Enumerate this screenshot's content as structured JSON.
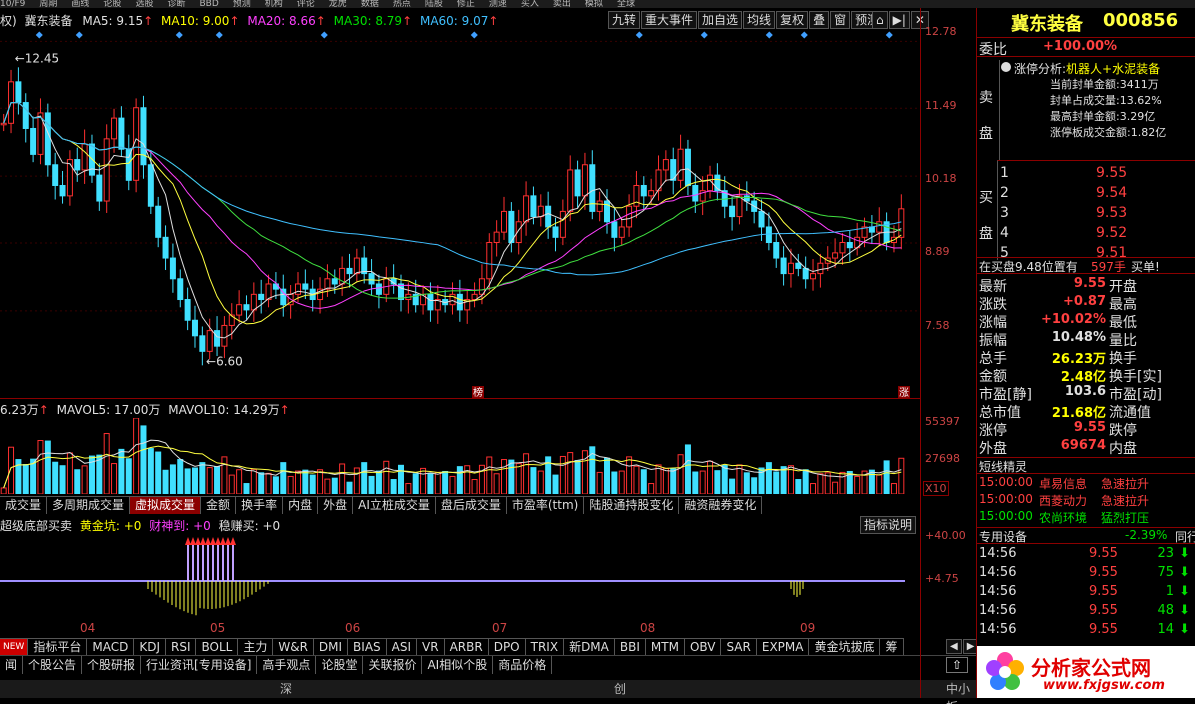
{
  "topbar": {
    "items": [
      "10/F9",
      "周期",
      "画线",
      "论股",
      "选股",
      "诊断",
      "BBD",
      "预测",
      "机构",
      "评论",
      "龙虎",
      "数据",
      "热点",
      "陆股",
      "修正",
      "测速",
      "买入",
      "卖出",
      "模拟",
      "全球"
    ]
  },
  "legend": {
    "prefix": "权)",
    "stock": "冀东装备",
    "ma5": "MA5: 9.15",
    "ma10": "MA10: 9.00",
    "ma20": "MA20: 8.66",
    "ma30": "MA30: 8.79",
    "ma60": "MA60: 9.07"
  },
  "toolbar": [
    "九转",
    "重大事件",
    "加自选",
    "均线",
    "复权",
    "叠",
    "窗",
    "预测"
  ],
  "price_axis": [
    "12.78",
    "11.49",
    "10.18",
    "8.89",
    "7.58"
  ],
  "annotations": {
    "high": "12.45",
    "low": "6.60",
    "bang": "榜",
    "zhang": "涨"
  },
  "vol_legend": {
    "vol": "6.23万",
    "mavol5": "MAVOL5: 17.00万",
    "mavol10": "MAVOL10: 14.29万"
  },
  "vol_axis": [
    "55397",
    "27698",
    "X10"
  ],
  "mid_tabs": [
    "成交量",
    "多周期成交量",
    "虚拟成交量",
    "金额",
    "换手率",
    "内盘",
    "外盘",
    "AI立桩成交量",
    "盘后成交量",
    "市盈率(ttm)",
    "陆股通持股变化",
    "融资融券变化"
  ],
  "mid_tab_selected": 2,
  "ind_legend": {
    "name": "超级底部买卖",
    "a": "黄金坑: +0",
    "b": "财神到: +0",
    "c": "稳赚买: +0",
    "explain": "指标说明"
  },
  "ind_axis": [
    "+40.00",
    "+4.75"
  ],
  "months": [
    "04",
    "05",
    "06",
    "07",
    "08",
    "09"
  ],
  "ind_tabs": [
    "指标平台",
    "MACD",
    "KDJ",
    "RSI",
    "BOLL",
    "主力",
    "W&R",
    "DMI",
    "BIAS",
    "ASI",
    "VR",
    "ARBR",
    "DPO",
    "TRIX",
    "新DMA",
    "BBI",
    "MTM",
    "OBV",
    "SAR",
    "EXPMA",
    "黄金坑拔底",
    "筹"
  ],
  "new_badge": "NEW",
  "bottom_tabs": [
    "闻",
    "个股公告",
    "个股研报",
    "行业资讯[专用设备]",
    "高手观点",
    "论股堂",
    "关联报价",
    "AI相似个股",
    "商品价格"
  ],
  "status": {
    "a": "深",
    "b": "创",
    "c": "中小板"
  },
  "panel": {
    "title_name": "冀东装备",
    "title_code": "000856",
    "weibi_label": "委比",
    "weibi": "+100.00%",
    "sell_label": "卖盘",
    "limit_label": "涨停分析:",
    "limit_topic": "机器人+水泥装备",
    "limit_lines": [
      "当前封单金额:3411万",
      "封单占成交量:13.62%",
      "最高封单金额:3.29亿",
      "涨停板成交金额:1.82亿"
    ],
    "buy_label": "买盘",
    "buy": [
      {
        "n": "1",
        "p": "9.55"
      },
      {
        "n": "2",
        "p": "9.54"
      },
      {
        "n": "3",
        "p": "9.53"
      },
      {
        "n": "4",
        "p": "9.52"
      },
      {
        "n": "5",
        "p": "9.51"
      }
    ],
    "pos_text": "在买盘9.48位置有",
    "pos_vol": "597手",
    "pos_type": "买单!",
    "quotes": [
      {
        "l": "最新",
        "v": "9.55",
        "r": "开盘",
        "c": "red"
      },
      {
        "l": "涨跌",
        "v": "+0.87",
        "r": "最高",
        "c": "red"
      },
      {
        "l": "涨幅",
        "v": "+10.02%",
        "r": "最低",
        "c": "red"
      },
      {
        "l": "振幅",
        "v": "10.48%",
        "r": "量比",
        "c": "wht"
      },
      {
        "l": "总手",
        "v": "26.23万",
        "r": "换手",
        "c": "yel"
      },
      {
        "l": "金额",
        "v": "2.48亿",
        "r": "换手[实]",
        "c": "yel"
      },
      {
        "l": "市盈[静]",
        "v": "103.6",
        "r": "市盈[动]",
        "c": "wht"
      },
      {
        "l": "总市值",
        "v": "21.68亿",
        "r": "流通值",
        "c": "yel"
      },
      {
        "l": "涨停",
        "v": "9.55",
        "r": "跌停",
        "c": "red"
      },
      {
        "l": "外盘",
        "v": "69674",
        "r": "内盘",
        "c": "red"
      }
    ],
    "sprite_title": "短线精灵",
    "sprites": [
      {
        "t": "15:00:00",
        "n": "卓易信息",
        "e": "急速拉升",
        "c": "red"
      },
      {
        "t": "15:00:00",
        "n": "西菱动力",
        "e": "急速拉升",
        "c": "red"
      },
      {
        "t": "15:00:00",
        "n": "农尚环境",
        "e": "猛烈打压",
        "c": "grn"
      }
    ],
    "sector": "专用设备",
    "sector_chg": "-2.39%",
    "sector_tab": "同行",
    "ticks": [
      {
        "t": "14:56",
        "p": "9.55",
        "v": "23"
      },
      {
        "t": "14:56",
        "p": "9.55",
        "v": "75"
      },
      {
        "t": "14:56",
        "p": "9.55",
        "v": "1"
      },
      {
        "t": "14:56",
        "p": "9.55",
        "v": "48"
      },
      {
        "t": "14:56",
        "p": "9.55",
        "v": "14"
      }
    ],
    "logo_text": "分析家公式网",
    "logo_url": "www.fxjgsw.com"
  },
  "chart_data": {
    "type": "candlestick",
    "price_range": [
      5.9,
      13.0
    ],
    "ticks_y": [
      12.78,
      11.49,
      10.18,
      8.89,
      7.58
    ],
    "close": [
      11.2,
      12.0,
      11.6,
      11.1,
      10.6,
      11.4,
      10.4,
      10.0,
      9.8,
      10.5,
      10.3,
      10.8,
      10.2,
      9.7,
      10.9,
      11.3,
      10.7,
      10.1,
      11.5,
      10.4,
      9.6,
      9.0,
      8.6,
      8.2,
      7.8,
      7.4,
      7.1,
      6.8,
      7.2,
      6.9,
      7.3,
      7.5,
      7.7,
      7.6,
      7.9,
      7.8,
      8.1,
      8.0,
      7.7,
      7.9,
      8.1,
      8.0,
      7.8,
      8.0,
      8.2,
      8.1,
      8.4,
      8.3,
      8.6,
      8.3,
      8.1,
      7.9,
      8.2,
      8.1,
      7.8,
      7.9,
      7.7,
      7.9,
      7.6,
      7.8,
      7.7,
      7.9,
      7.6,
      7.8,
      7.9,
      8.2,
      8.9,
      9.1,
      9.5,
      8.9,
      9.3,
      9.8,
      9.4,
      9.6,
      9.2,
      9.0,
      9.5,
      10.3,
      9.8,
      10.4,
      9.5,
      9.7,
      9.3,
      9.0,
      9.2,
      9.6,
      10.0,
      9.8,
      9.9,
      10.3,
      10.5,
      10.1,
      10.7,
      10.0,
      9.7,
      9.9,
      10.2,
      9.9,
      9.6,
      9.4,
      9.8,
      9.7,
      9.5,
      9.2,
      8.9,
      8.6,
      8.3,
      8.5,
      8.4,
      8.2,
      8.3,
      8.5,
      8.6,
      8.7,
      8.9,
      8.8,
      9.0,
      9.2,
      9.1,
      9.3,
      8.9,
      9.0,
      9.55
    ],
    "volume_max": 55397
  }
}
